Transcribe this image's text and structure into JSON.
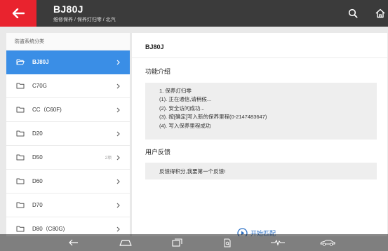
{
  "header": {
    "title": "BJ80J",
    "subtitle": "维修保养 / 保养灯归零 / 北汽",
    "icons": [
      "back-arrow-icon",
      "search-icon",
      "home-icon"
    ],
    "accent_color": "#e9232e"
  },
  "left_panel": {
    "heading": "防盗系统分类",
    "items": [
      {
        "label": "BJ80J",
        "selected": true,
        "count": ""
      },
      {
        "label": "C70G",
        "selected": false,
        "count": ""
      },
      {
        "label": "CC（C60F)",
        "selected": false,
        "count": ""
      },
      {
        "label": "D20",
        "selected": false,
        "count": ""
      },
      {
        "label": "D50",
        "selected": false,
        "count": "2项"
      },
      {
        "label": "D60",
        "selected": false,
        "count": ""
      },
      {
        "label": "D70",
        "selected": false,
        "count": ""
      },
      {
        "label": "D80（C80G)",
        "selected": false,
        "count": ""
      }
    ]
  },
  "detail": {
    "model": "BJ80J",
    "intro_title": "功能介绍",
    "intro_lines": [
      "1. 保养灯归零",
      "(1). 正在通信,请稍候...",
      "(2). 安全访问成功...",
      "(3). 按[确定]写入新的保养里程(0-2147483647)",
      "(4). 写入保养里程成功"
    ],
    "feedback_title": "用户反馈",
    "feedback_text": "反馈得积分,我要第一个反馈!",
    "start_button": "开始匹配"
  },
  "navbar": {
    "icons": [
      "nav-back-icon",
      "nav-home-icon",
      "nav-recents-icon",
      "doc-search-icon",
      "pulse-icon",
      "car-icon"
    ]
  }
}
